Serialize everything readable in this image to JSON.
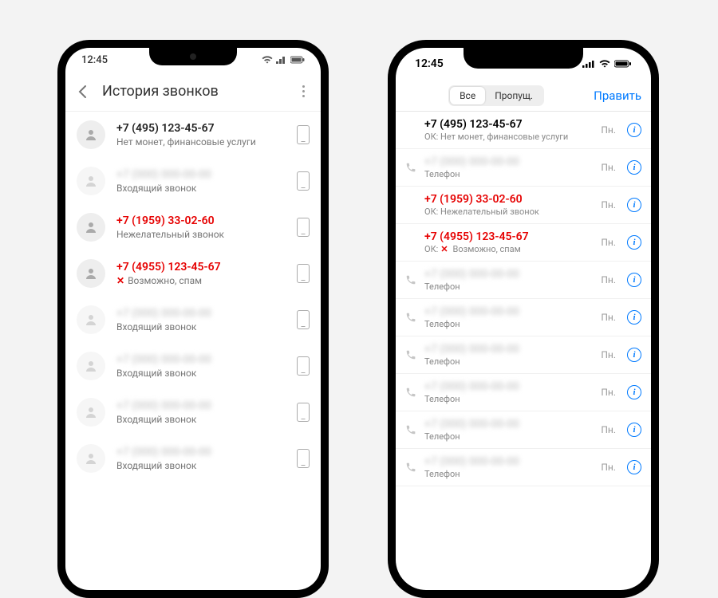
{
  "status_time": "12:45",
  "android": {
    "header_title": "История звонков",
    "rows": [
      {
        "line1": "+7 (495) 123-45-67",
        "line2": "Нет монет, финансовые услуги",
        "red": false,
        "blur": false,
        "x": false
      },
      {
        "line1": "+7 (000) 000-00-00",
        "line2": "Входящий звонок",
        "red": false,
        "blur": true,
        "x": false
      },
      {
        "line1": "+7 (1959) 33-02-60",
        "line2": "Нежелательный звонок",
        "red": true,
        "blur": false,
        "x": false
      },
      {
        "line1": "+7 (4955) 123-45-67",
        "line2": "Возможно, спам",
        "red": true,
        "blur": false,
        "x": true
      },
      {
        "line1": "+7 (000) 000-00-00",
        "line2": "Входящий звонок",
        "red": false,
        "blur": true,
        "x": false
      },
      {
        "line1": "+7 (000) 000-00-00",
        "line2": "Входящий звонок",
        "red": false,
        "blur": true,
        "x": false
      },
      {
        "line1": "+7 (000) 000-00-00",
        "line2": "Входящий звонок",
        "red": false,
        "blur": true,
        "x": false
      },
      {
        "line1": "+7 (000) 000-00-00",
        "line2": "Входящий звонок",
        "red": false,
        "blur": true,
        "x": false
      }
    ]
  },
  "iphone": {
    "seg_all": "Все",
    "seg_missed": "Пропущ.",
    "edit": "Править",
    "day": "Пн.",
    "rows": [
      {
        "line1": "+7 (495) 123-45-67",
        "line2": "ОК: Нет монет, финансовые услуги",
        "red": false,
        "blur": false,
        "icon": false,
        "x": false
      },
      {
        "line1": "+7 (000) 000-00-00",
        "line2": "Телефон",
        "red": false,
        "blur": true,
        "icon": true,
        "x": false
      },
      {
        "line1": "+7 (1959) 33-02-60",
        "line2": "ОК: Нежелательный звонок",
        "red": true,
        "blur": false,
        "icon": false,
        "x": false
      },
      {
        "line1": "+7 (4955) 123-45-67",
        "line2": "Возможно, спам",
        "red": true,
        "blur": false,
        "icon": false,
        "x": true,
        "prefix": "ОК: "
      },
      {
        "line1": "+7 (000) 000-00-00",
        "line2": "Телефон",
        "red": false,
        "blur": true,
        "icon": true,
        "x": false
      },
      {
        "line1": "+7 (000) 000-00-00",
        "line2": "Телефон",
        "red": false,
        "blur": true,
        "icon": true,
        "x": false
      },
      {
        "line1": "+7 (000) 000-00-00",
        "line2": "Телефон",
        "red": false,
        "blur": true,
        "icon": true,
        "x": false
      },
      {
        "line1": "+7 (000) 000-00-00",
        "line2": "Телефон",
        "red": false,
        "blur": true,
        "icon": true,
        "x": false
      },
      {
        "line1": "+7 (000) 000-00-00",
        "line2": "Телефон",
        "red": false,
        "blur": true,
        "icon": true,
        "x": false
      },
      {
        "line1": "+7 (000) 000-00-00",
        "line2": "Телефон",
        "red": false,
        "blur": true,
        "icon": true,
        "x": false
      }
    ]
  }
}
